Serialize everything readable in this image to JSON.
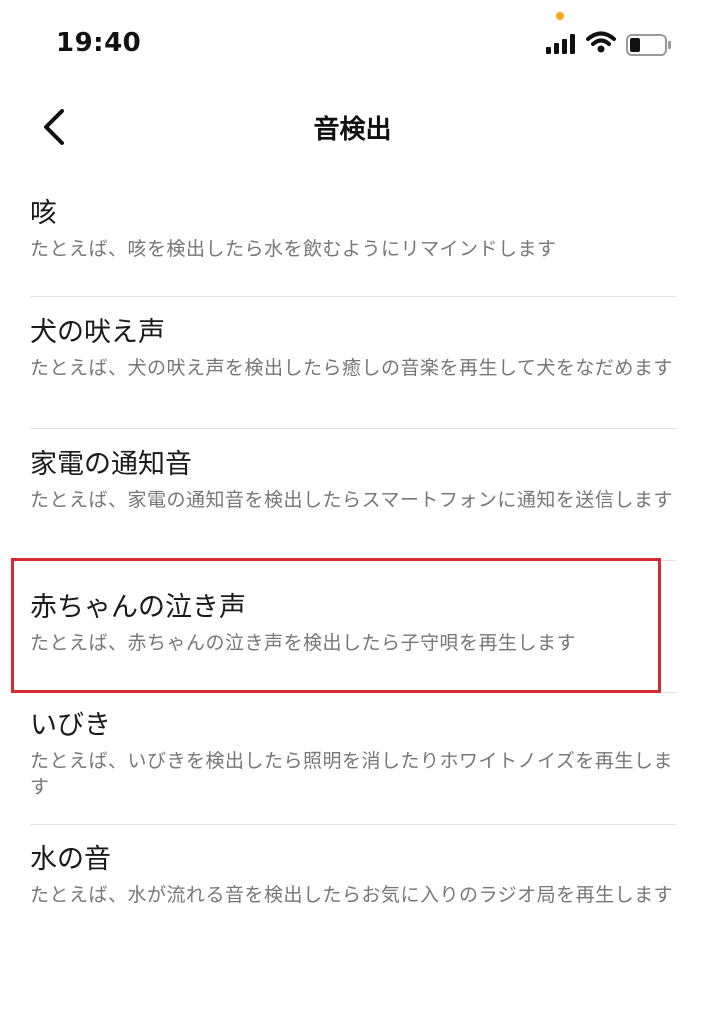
{
  "status_bar": {
    "time": "19:40",
    "icons": [
      "cellular-signal-icon",
      "wifi-icon",
      "battery-icon"
    ],
    "privacy_indicator_color": "#f5a623"
  },
  "nav": {
    "back_icon": "chevron-left-icon",
    "title": "音検出"
  },
  "items": [
    {
      "title": "咳",
      "description": "たとえば、咳を検出したら水を飲むようにリマインドします"
    },
    {
      "title": "犬の吠え声",
      "description": "たとえば、犬の吠え声を検出したら癒しの音楽を再生して犬をなだめます"
    },
    {
      "title": "家電の通知音",
      "description": "たとえば、家電の通知音を検出したらスマートフォンに通知を送信します"
    },
    {
      "title": "赤ちゃんの泣き声",
      "description": "たとえば、赤ちゃんの泣き声を検出したら子守唄を再生します",
      "highlighted": true
    },
    {
      "title": "いびき",
      "description": "たとえば、いびきを検出したら照明を消したりホワイトノイズを再生します"
    },
    {
      "title": "水の音",
      "description": "たとえば、水が流れる音を検出したらお気に入りのラジオ局を再生します"
    }
  ],
  "colors": {
    "highlight_border": "#d62b34",
    "description_text": "#777777",
    "divider": "#e2e2e2"
  }
}
